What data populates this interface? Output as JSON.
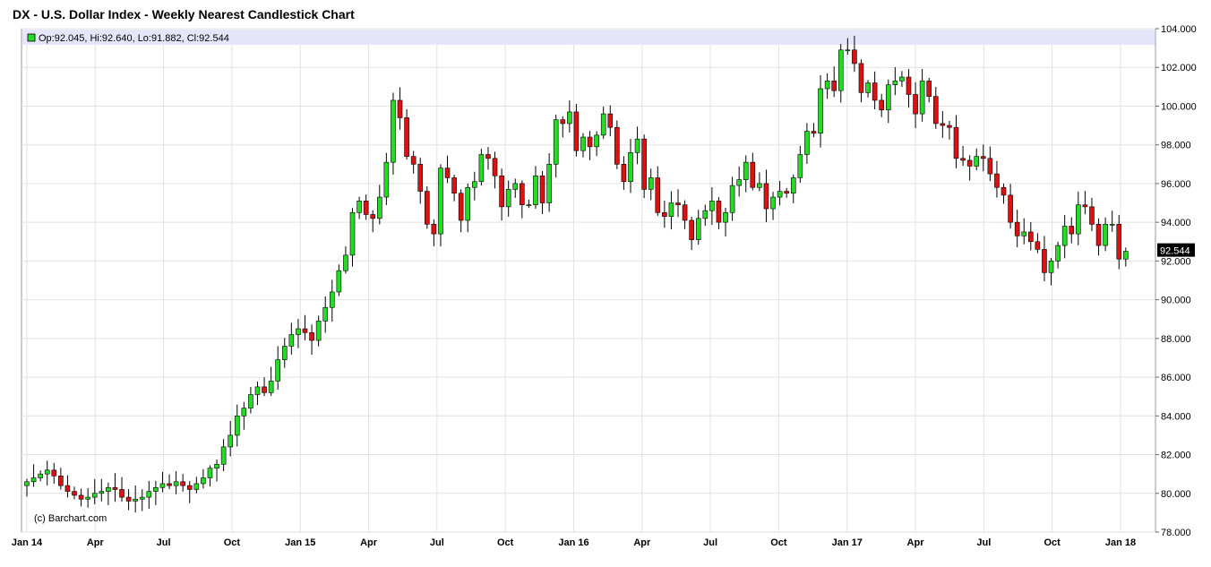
{
  "chart_data": {
    "type": "candlestick",
    "title": "DX - U.S. Dollar Index - Weekly Nearest Candlestick Chart",
    "ohlc_text": "Op:92.045, Hi:92.640, Lo:91.882, Cl:92.544",
    "watermark": "(c) Barchart.com",
    "last_price_label": "92.544",
    "last_price": 92.544,
    "ylim": [
      78,
      104
    ],
    "ylabels": [
      "104.000",
      "102.000",
      "100.000",
      "98.000",
      "96.000",
      "94.000",
      "92.000",
      "90.000",
      "88.000",
      "86.000",
      "84.000",
      "82.000",
      "80.000",
      "78.000"
    ],
    "yvalues": [
      104,
      102,
      100,
      98,
      96,
      94,
      92,
      90,
      88,
      86,
      84,
      82,
      80,
      78
    ],
    "xlabels": [
      "Jan 14",
      "Apr",
      "Jul",
      "Oct",
      "Jan 15",
      "Apr",
      "Jul",
      "Oct",
      "Jan 16",
      "Apr",
      "Jul",
      "Oct",
      "Jan 17",
      "Apr",
      "Jul",
      "Oct",
      "Jan 18"
    ],
    "xlabel_weeks": [
      0,
      13,
      26,
      39,
      52,
      65,
      78,
      91,
      104,
      117,
      130,
      143,
      156,
      169,
      182,
      195,
      208
    ],
    "grid": true,
    "up_color": "#22dd22",
    "down_color": "#dd1111",
    "highlight_band_color": "#e6e6fa",
    "close_series": [
      80.6,
      80.8,
      81.0,
      81.2,
      80.9,
      80.4,
      80.1,
      79.9,
      79.7,
      79.8,
      80.0,
      80.1,
      80.3,
      80.2,
      79.8,
      79.6,
      79.7,
      79.8,
      80.1,
      80.3,
      80.5,
      80.4,
      80.6,
      80.4,
      80.2,
      80.5,
      80.8,
      81.3,
      81.5,
      82.4,
      83.0,
      84.0,
      84.4,
      85.1,
      85.5,
      85.2,
      85.8,
      86.9,
      87.6,
      88.2,
      88.5,
      88.3,
      87.9,
      88.9,
      89.6,
      90.4,
      91.5,
      92.3,
      94.5,
      95.1,
      94.4,
      94.2,
      95.3,
      97.1,
      100.3,
      99.4,
      97.4,
      97.0,
      95.6,
      93.9,
      93.4,
      96.8,
      96.3,
      95.5,
      94.1,
      95.8,
      96.1,
      97.5,
      97.3,
      96.4,
      94.8,
      95.7,
      96.0,
      94.9,
      94.9,
      96.4,
      95.0,
      97.0,
      99.3,
      99.1,
      99.7,
      97.7,
      98.4,
      97.9,
      98.5,
      99.6,
      98.9,
      97.0,
      96.1,
      97.6,
      98.3,
      95.7,
      96.3,
      94.5,
      94.3,
      95.0,
      94.9,
      94.1,
      93.1,
      94.2,
      94.6,
      95.1,
      94.0,
      94.5,
      95.9,
      96.2,
      97.1,
      95.8,
      96.0,
      94.7,
      95.3,
      95.6,
      95.5,
      96.3,
      97.5,
      98.7,
      98.6,
      100.9,
      101.3,
      100.8,
      102.9,
      102.9,
      102.2,
      100.7,
      101.2,
      100.3,
      99.8,
      101.1,
      101.3,
      101.5,
      100.6,
      99.6,
      101.3,
      100.5,
      99.1,
      99.0,
      98.9,
      97.3,
      97.2,
      96.9,
      97.4,
      97.3,
      96.5,
      95.8,
      95.4,
      94.0,
      93.3,
      93.5,
      93.0,
      92.6,
      91.4,
      92.0,
      92.8,
      93.8,
      93.4,
      94.9,
      94.8,
      93.9,
      92.8,
      93.9,
      93.9,
      92.1,
      92.5
    ],
    "n_weeks": 210
  }
}
